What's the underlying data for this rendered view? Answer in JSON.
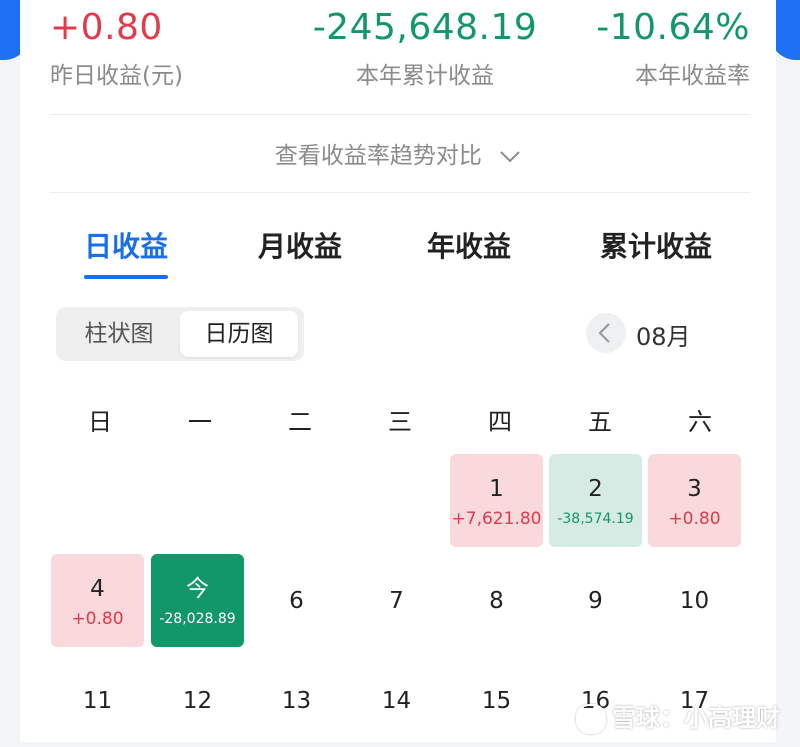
{
  "summary": {
    "yesterday": {
      "value": "+0.80",
      "label": "昨日收益(元)"
    },
    "year_cum": {
      "value": "-245,648.19",
      "label": "本年累计收益"
    },
    "year_rate": {
      "value": "-10.64%",
      "label": "本年收益率"
    }
  },
  "trend_link": "查看收益率趋势对比",
  "tabs": [
    "日收益",
    "月收益",
    "年收益",
    "累计收益"
  ],
  "view_toggle": [
    "柱状图",
    "日历图"
  ],
  "month": "08月",
  "weekdays": [
    "日",
    "一",
    "二",
    "三",
    "四",
    "五",
    "六"
  ],
  "days": [
    {
      "n": "1",
      "p": "+7,621.80",
      "state": "positive"
    },
    {
      "n": "2",
      "p": "-38,574.19",
      "state": "negative"
    },
    {
      "n": "3",
      "p": "+0.80",
      "state": "positive"
    },
    {
      "n": "4",
      "p": "+0.80",
      "state": "positive"
    },
    {
      "n": "今",
      "p": "-28,028.89",
      "state": "today"
    },
    {
      "n": "6"
    },
    {
      "n": "7"
    },
    {
      "n": "8"
    },
    {
      "n": "9"
    },
    {
      "n": "10"
    },
    {
      "n": "11"
    },
    {
      "n": "12"
    },
    {
      "n": "13"
    },
    {
      "n": "14"
    },
    {
      "n": "15"
    },
    {
      "n": "16"
    },
    {
      "n": "17"
    }
  ],
  "watermark": "雪球：小高理财",
  "colors": {
    "accent": "#1a6fe8",
    "gain": "#e03a4b",
    "loss": "#12976a"
  }
}
